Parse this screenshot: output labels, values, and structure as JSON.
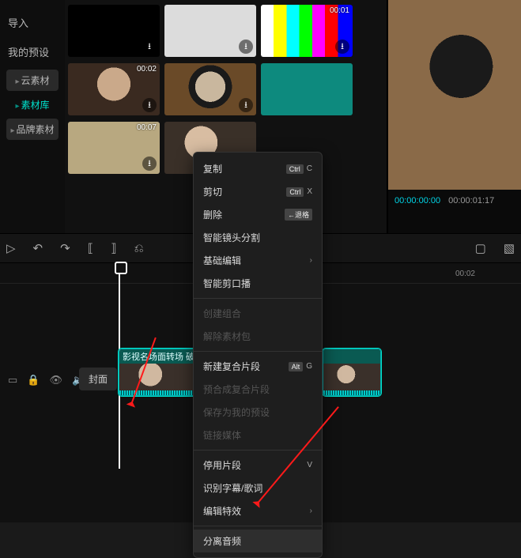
{
  "sidebar": {
    "items": [
      {
        "label": "导入",
        "style": "plain"
      },
      {
        "label": "我的预设",
        "style": "plain"
      },
      {
        "label": "云素材",
        "style": "tag grey"
      },
      {
        "label": "素材库",
        "style": "tag active"
      },
      {
        "label": "品牌素材",
        "style": "tag grey"
      }
    ]
  },
  "thumbnails": [
    {
      "cls": "black",
      "dur": "",
      "dl": true
    },
    {
      "cls": "white",
      "dur": "",
      "dl": true
    },
    {
      "cls": "bars",
      "dur": "00:01",
      "dl": true
    },
    {
      "cls": "photo1",
      "dur": "00:02",
      "dl": true
    },
    {
      "cls": "photo2",
      "dur": "",
      "dl": true
    },
    {
      "cls": "teal",
      "dur": "",
      "dl": false
    },
    {
      "cls": "wash",
      "dur": "00:07",
      "dl": true
    },
    {
      "cls": "photo3",
      "dur": "",
      "dl": false
    }
  ],
  "preview": {
    "tc_current": "00:00:00:00",
    "tc_total": "00:00:01:17"
  },
  "toolbar": {
    "cursor": "▷",
    "undo": "↶",
    "redo": "↷",
    "cut_in": "⟦",
    "cut_out": "⟧",
    "split": "⎌",
    "crop": "▢",
    "speed": "▧"
  },
  "ruler": {
    "t0": "0",
    "t1": "00:02"
  },
  "track": {
    "cover": "封面",
    "clip_label": "影视名场面转场 破..."
  },
  "context_menu": [
    {
      "label": "复制",
      "shortcut_key": "Ctrl",
      "shortcut_ch": "C",
      "type": "item"
    },
    {
      "label": "剪切",
      "shortcut_key": "Ctrl",
      "shortcut_ch": "X",
      "type": "item"
    },
    {
      "label": "删除",
      "shortcut_key": "←退格",
      "shortcut_ch": "",
      "type": "item"
    },
    {
      "label": "智能镜头分割",
      "type": "item"
    },
    {
      "label": "基础编辑",
      "type": "submenu"
    },
    {
      "label": "智能剪口播",
      "type": "item"
    },
    {
      "type": "sep"
    },
    {
      "label": "创建组合",
      "type": "disabled"
    },
    {
      "label": "解除素材包",
      "type": "disabled"
    },
    {
      "type": "sep"
    },
    {
      "label": "新建复合片段",
      "shortcut_key": "Alt",
      "shortcut_ch": "G",
      "type": "item"
    },
    {
      "label": "预合成复合片段",
      "type": "disabled"
    },
    {
      "label": "保存为我的预设",
      "type": "disabled"
    },
    {
      "label": "链接媒体",
      "type": "disabled"
    },
    {
      "type": "sep"
    },
    {
      "label": "停用片段",
      "shortcut_ch": "V",
      "type": "item"
    },
    {
      "label": "识别字幕/歌词",
      "type": "item"
    },
    {
      "label": "编辑特效",
      "type": "submenu"
    },
    {
      "type": "sep"
    },
    {
      "label": "分离音频",
      "type": "item",
      "hl": true
    }
  ]
}
